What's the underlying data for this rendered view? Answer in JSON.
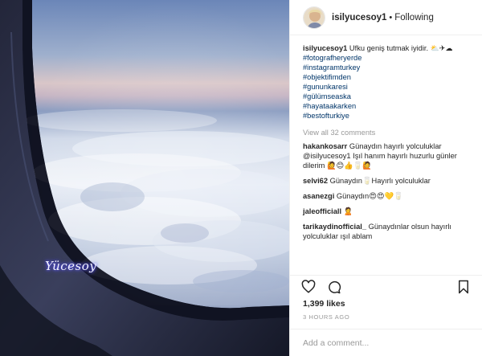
{
  "post": {
    "author": {
      "username": "isilyucesoy1",
      "separator": "•",
      "follow_status": "Following",
      "avatar_icon": "avatar-photo"
    },
    "image": {
      "signature_text": "Yücesoy"
    },
    "caption": {
      "username": "isilyucesoy1",
      "text": "Ufku geniş tutmak iyidir.",
      "emoji": "⛅✈☁",
      "hashtags": [
        "#fotografheryerde",
        "#instagramturkey",
        "#objektifimden",
        "#gununkaresi",
        "#gülümseaska",
        "#hayataakarken",
        "#bestofturkiye"
      ]
    },
    "view_all_comments": "View all 32 comments",
    "comments": [
      {
        "username": "hakankosarr",
        "text": "Günaydın hayırlı yolculuklar @isilyucesoy1 Işıl hanım hayırlı huzurlu günler dilerim 🙋😊👍🥛🙋"
      },
      {
        "username": "selvi62",
        "text": "Günaydın🥛Hayırlı yolculuklar"
      },
      {
        "username": "asanezgi",
        "text": "Günaydın😍😍💛🥛"
      },
      {
        "username": "jaleofficiall",
        "text": "🙎"
      },
      {
        "username": "tarikaydinofficial_",
        "text": "Günaydınlar olsun hayırlı yolculuklar ışıl ablam"
      }
    ],
    "actions": {
      "like_icon": "heart-icon",
      "comment_icon": "comment-icon",
      "save_icon": "bookmark-icon"
    },
    "likes": "1,399 likes",
    "timestamp": "3 HOURS AGO",
    "add_comment_placeholder": "Add a comment..."
  },
  "colors": {
    "text": "#262626",
    "muted": "#999999",
    "hashtag": "#003569",
    "border": "#efefef"
  }
}
